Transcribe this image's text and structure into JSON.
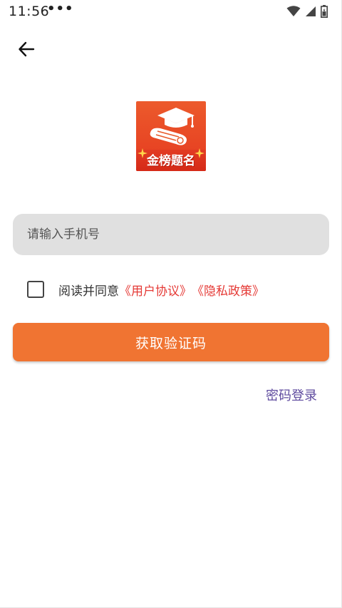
{
  "status_bar": {
    "time": "11:56",
    "dots": "•••"
  },
  "logo": {
    "text": "金榜题名"
  },
  "form": {
    "phone_placeholder": "请输入手机号",
    "phone_value": ""
  },
  "agreement": {
    "prefix": "阅读并同意",
    "user_agreement": "《用户协议》",
    "privacy_policy": "《隐私政策》",
    "checked": false
  },
  "buttons": {
    "get_code": "获取验证码",
    "password_login": "密码登录"
  },
  "colors": {
    "primary_button": "#f07432",
    "link_red": "#e53935",
    "link_purple": "#5e4a9e",
    "input_bg": "#e0e0e0"
  }
}
